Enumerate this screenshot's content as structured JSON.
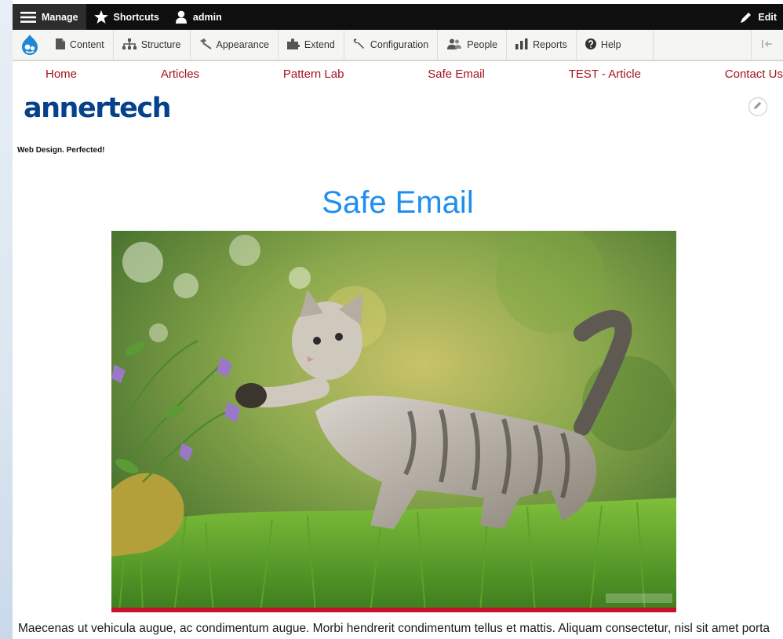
{
  "toolbar": {
    "manage": "Manage",
    "shortcuts": "Shortcuts",
    "user": "admin",
    "edit": "Edit"
  },
  "tray": {
    "items": [
      {
        "label": "Content",
        "icon": "content-icon"
      },
      {
        "label": "Structure",
        "icon": "structure-icon"
      },
      {
        "label": "Appearance",
        "icon": "appearance-icon"
      },
      {
        "label": "Extend",
        "icon": "extend-icon"
      },
      {
        "label": "Configuration",
        "icon": "configuration-icon"
      },
      {
        "label": "People",
        "icon": "people-icon"
      },
      {
        "label": "Reports",
        "icon": "reports-icon"
      },
      {
        "label": "Help",
        "icon": "help-icon"
      }
    ]
  },
  "nav": {
    "items": [
      "Home",
      "Articles",
      "Pattern Lab",
      "Safe Email",
      "TEST - Article",
      "Contact Us"
    ]
  },
  "site": {
    "name": "annertech",
    "slogan": "Web Design. Perfected!"
  },
  "page": {
    "title": "Safe Email",
    "body": "Maecenas ut vehicula augue, ac condimentum augue. Morbi hendrerit condimentum tellus et mattis. Aliquam consectetur, nisl sit amet porta"
  },
  "colors": {
    "toolbar_bg": "#0f0f0f",
    "nav_link": "#a3131f",
    "title": "#1e8ef0",
    "logo": "#06418b",
    "image_border": "#c8102e"
  }
}
